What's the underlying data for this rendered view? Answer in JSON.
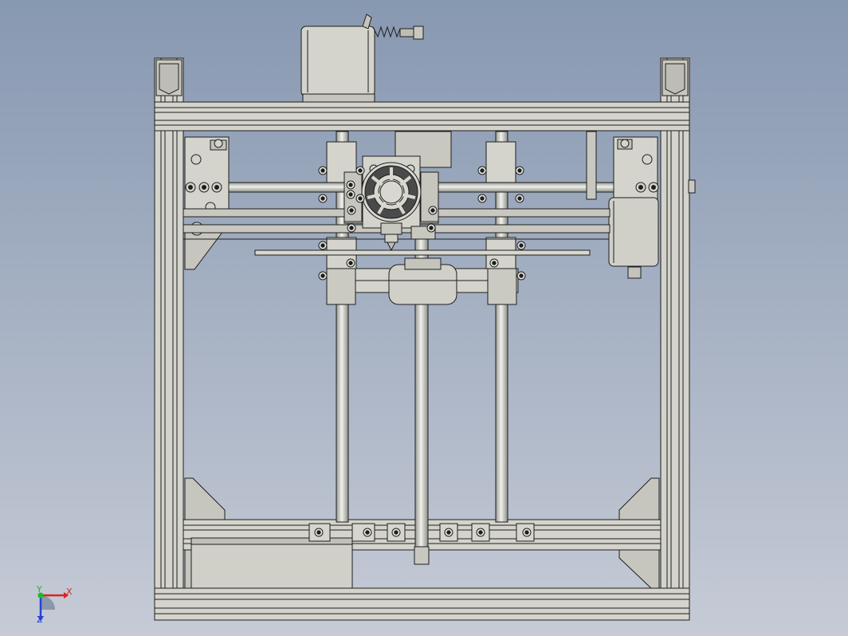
{
  "view": {
    "background_top": "#8798b1",
    "background_bottom": "#c6cbd6"
  },
  "model": {
    "part_fill": "#d4d4cc",
    "part_shade": "#b9b9b0",
    "edge_color": "#1e1e1e",
    "fan_color": "#4a4a4a"
  },
  "triad": {
    "x_label": "X",
    "y_label": "Y",
    "z_label": "Z",
    "x_color": "#e0201c",
    "y_color": "#1fb82a",
    "z_color": "#2443d6"
  }
}
